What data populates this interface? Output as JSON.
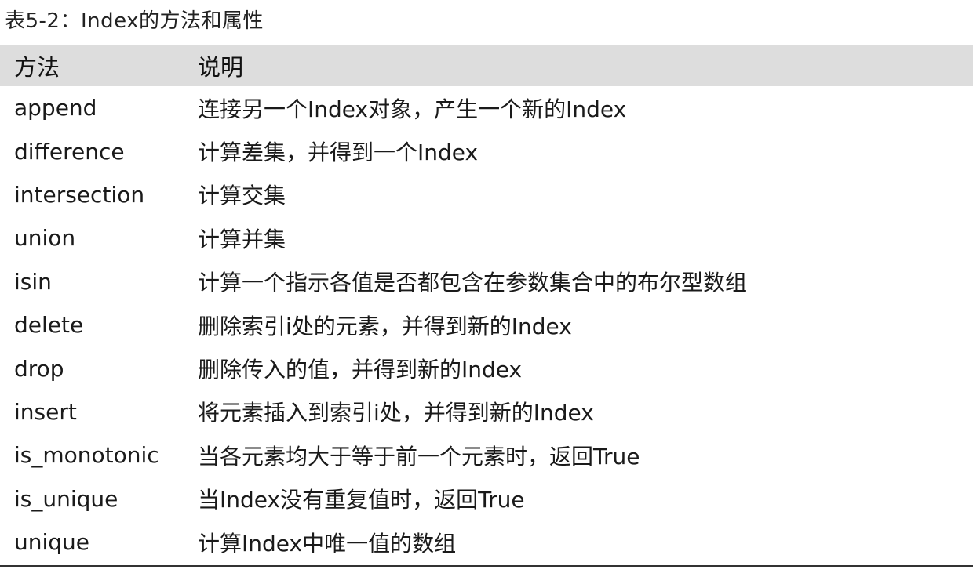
{
  "caption": "表5-2：Index的方法和属性",
  "table": {
    "headers": [
      "方法",
      "说明"
    ],
    "rows": [
      {
        "method": "append",
        "description": "连接另一个Index对象，产生一个新的Index"
      },
      {
        "method": "difference",
        "description": "计算差集，并得到一个Index"
      },
      {
        "method": "intersection",
        "description": "计算交集"
      },
      {
        "method": "union",
        "description": "计算并集"
      },
      {
        "method": "isin",
        "description": "计算一个指示各值是否都包含在参数集合中的布尔型数组"
      },
      {
        "method": "delete",
        "description": "删除索引i处的元素，并得到新的Index"
      },
      {
        "method": "drop",
        "description": "删除传入的值，并得到新的Index"
      },
      {
        "method": "insert",
        "description": "将元素插入到索引i处，并得到新的Index"
      },
      {
        "method": "is_monotonic",
        "description": "当各元素均大于等于前一个元素时，返回True"
      },
      {
        "method": "is_unique",
        "description": "当Index没有重复值时，返回True"
      },
      {
        "method": "unique",
        "description": "计算Index中唯一值的数组"
      }
    ]
  },
  "colors": {
    "header_bg": "#dddddd",
    "rule": "#333333"
  }
}
